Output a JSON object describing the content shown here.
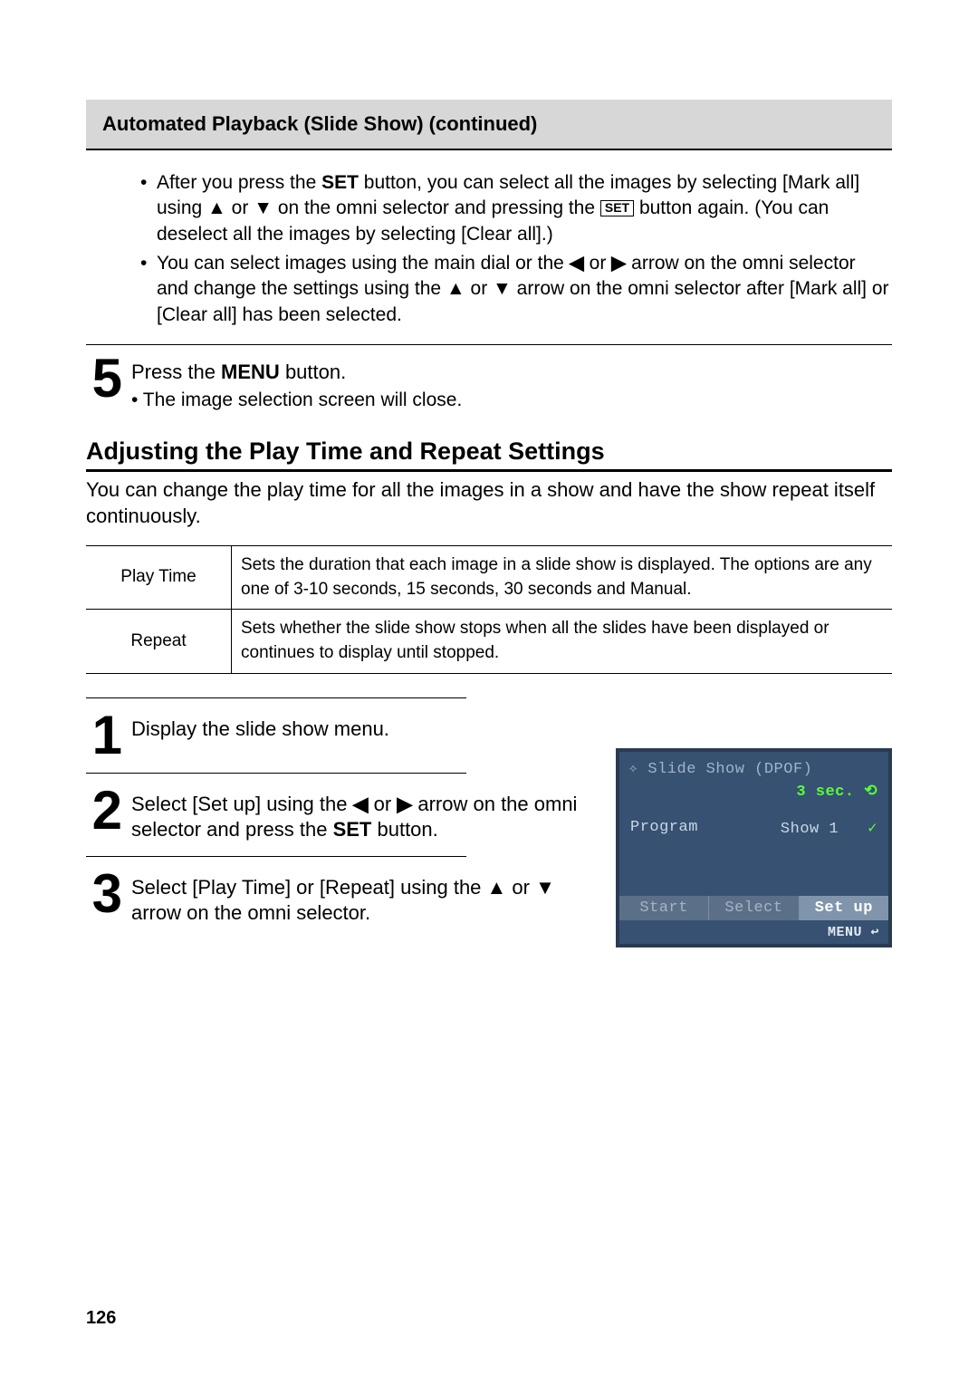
{
  "header": "Automated Playback (Slide Show) (continued)",
  "bullets": {
    "b1_a": "After you press the ",
    "b1_set": "SET",
    "b1_b": " button, you can select all the images by selecting [Mark all] using ",
    "b1_up": "▲",
    "b1_or": " or ",
    "b1_down": "▼",
    "b1_c": " on the omni selector and pressing the ",
    "b1_set2": "SET",
    "b1_d": " button again. (You can deselect all the images by selecting [Clear all].)",
    "b2_a": "You can select images using the main dial or the ",
    "b2_left": "◀",
    "b2_or1": " or ",
    "b2_right": "▶",
    "b2_b": " arrow on the omni selector and change the settings using the ",
    "b2_up": "▲",
    "b2_or2": " or ",
    "b2_down": "▼",
    "b2_c": " arrow on the omni selector after [Mark all] or [Clear all] has been selected."
  },
  "step5": {
    "num": "5",
    "lead_a": "Press the ",
    "menu": "MENU",
    "lead_b": " button.",
    "sub": "• The image selection screen will close."
  },
  "section_title": "Adjusting the Play Time and Repeat Settings",
  "intro": "You can change the play time for all the images in a show and have the show repeat itself continuously.",
  "table": {
    "r1_label": "Play Time",
    "r1_text": "Sets the duration that each image in a slide show is displayed. The options are any one of 3-10 seconds, 15 seconds, 30 seconds and Manual.",
    "r2_label": "Repeat",
    "r2_text": "Sets whether the slide show stops when all the slides have been displayed or continues to display until stopped."
  },
  "steps": {
    "s1_num": "1",
    "s1_text": "Display the slide show menu.",
    "s2_num": "2",
    "s2_a": "Select [Set up] using the ",
    "s2_left": "◀",
    "s2_or": " or ",
    "s2_right": "▶",
    "s2_b": " arrow on the omni selector and press the ",
    "s2_set": "SET",
    "s2_c": " button.",
    "s3_num": "3",
    "s3_a": "Select [Play Time] or [Repeat] using the ",
    "s3_up": "▲",
    "s3_or": " or ",
    "s3_down": "▼",
    "s3_b": " arrow on the omni selector."
  },
  "screen": {
    "title": "✧ Slide Show (DPOF)",
    "time": "3 sec. ⟲",
    "program_label": "Program",
    "show_label": "Show 1",
    "check": "✓",
    "btn_start": "Start",
    "btn_select": "Select",
    "btn_setup": "Set up",
    "menu": "MENU ↩"
  },
  "page_num": "126"
}
